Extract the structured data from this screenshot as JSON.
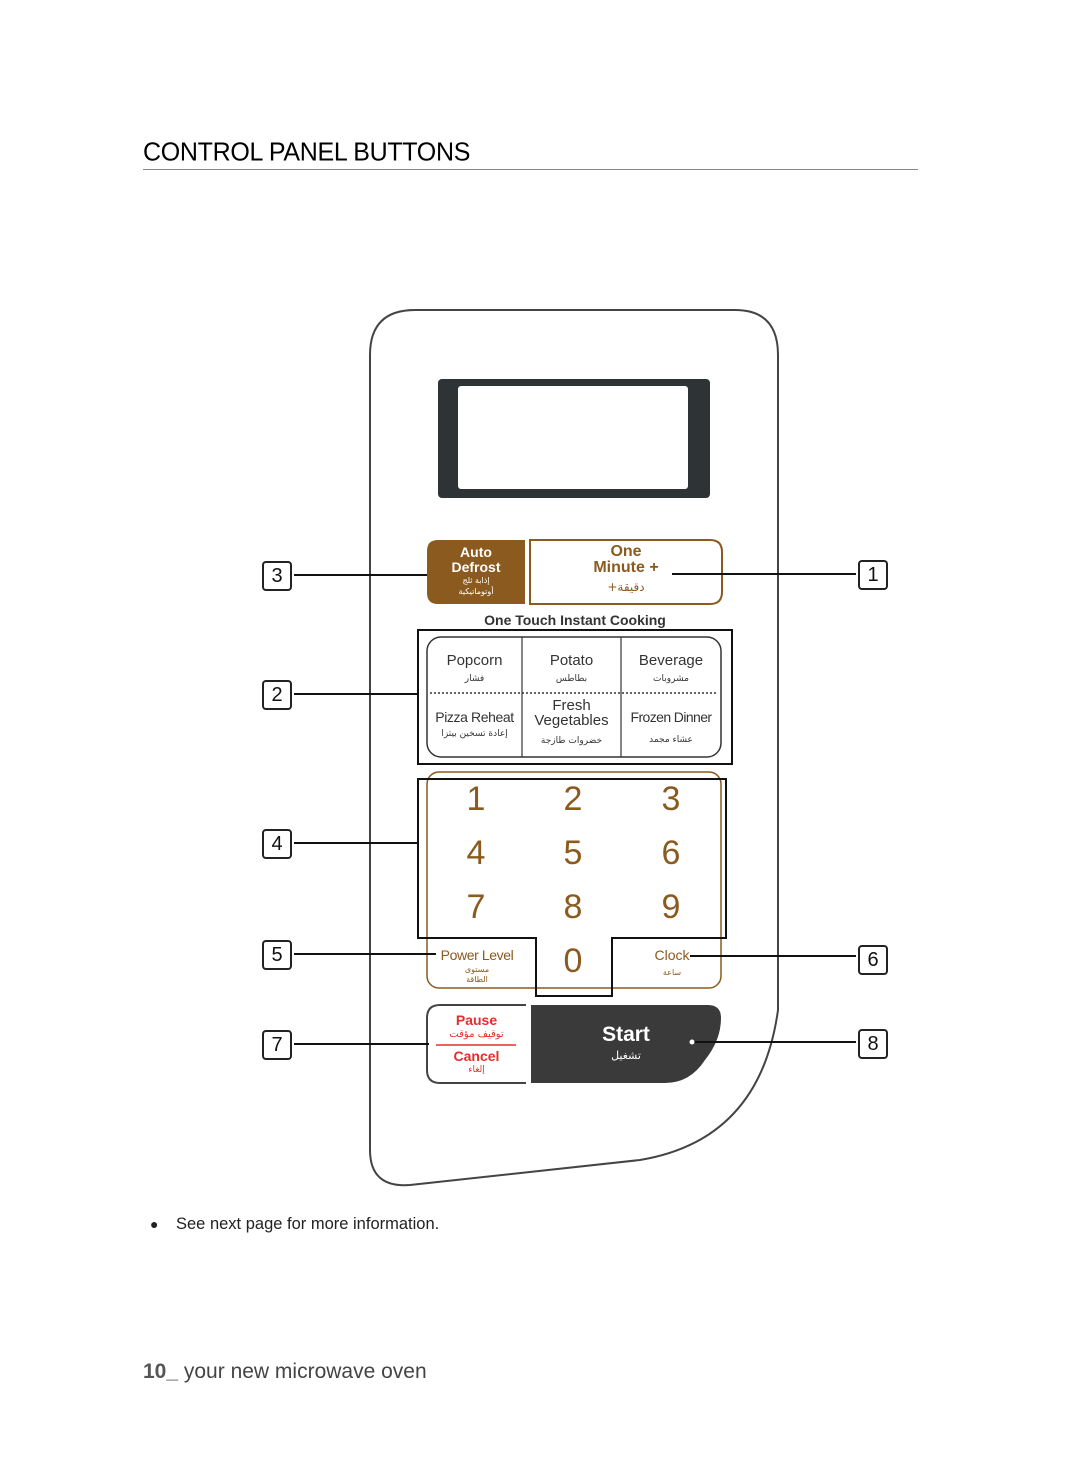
{
  "page": {
    "title": "CONTROL PANEL BUTTONS",
    "note": "See next page for more information.",
    "footer_page_number": "10_",
    "footer_text": " your new microwave oven"
  },
  "colors": {
    "brown": "#8a5a1e",
    "red": "#e52d2d",
    "dark": "#3a3a3a",
    "display_frame": "#2e3436"
  },
  "callouts": [
    {
      "number": "3",
      "target": "auto-defrost"
    },
    {
      "number": "2",
      "target": "one-touch-cooking"
    },
    {
      "number": "4",
      "target": "number-pad"
    },
    {
      "number": "5",
      "target": "power-level"
    },
    {
      "number": "7",
      "target": "pause-cancel"
    },
    {
      "number": "1",
      "target": "one-minute-plus"
    },
    {
      "number": "6",
      "target": "clock"
    },
    {
      "number": "8",
      "target": "start"
    }
  ],
  "panel": {
    "auto_defrost": {
      "line1": "Auto",
      "line2": "Defrost",
      "ar1": "إذابة ثلج",
      "ar2": "أوتوماتيكية"
    },
    "one_minute": {
      "line1": "One",
      "line2": "Minute +",
      "ar": "دقيقة+"
    },
    "one_touch_label": "One Touch Instant Cooking",
    "cooking_buttons": [
      {
        "label": "Popcorn",
        "ar": "فشار"
      },
      {
        "label": "Potato",
        "ar": "بطاطس"
      },
      {
        "label": "Beverage",
        "ar": "مشروبات"
      },
      {
        "label": "Pizza Reheat",
        "ar": "إعادة تسخين بيتزا"
      },
      {
        "label": "Fresh Vegetables",
        "ar": "خضروات طازجة"
      },
      {
        "label": "Frozen Dinner",
        "ar": "عشاء مجمد"
      }
    ],
    "digits": [
      "1",
      "2",
      "3",
      "4",
      "5",
      "6",
      "7",
      "8",
      "9",
      "0"
    ],
    "power_level": {
      "label": "Power Level",
      "ar1": "مستوى",
      "ar2": "الطاقة"
    },
    "clock": {
      "label": "Clock",
      "ar": "ساعة"
    },
    "pause_cancel": {
      "pause": "Pause",
      "pause_ar": "توقيف مؤقت",
      "cancel": "Cancel",
      "cancel_ar": "إلغاء"
    },
    "start": {
      "label": "Start",
      "ar": "تشغيل"
    }
  }
}
